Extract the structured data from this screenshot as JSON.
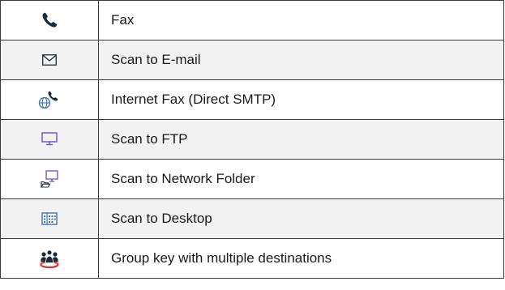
{
  "rows": [
    {
      "icon": "phone-icon",
      "label": "Fax"
    },
    {
      "icon": "envelope-icon",
      "label": "Scan to E-mail"
    },
    {
      "icon": "globe-phone-icon",
      "label": "Internet Fax (Direct SMTP)"
    },
    {
      "icon": "monitor-icon",
      "label": "Scan to FTP"
    },
    {
      "icon": "monitor-folder-icon",
      "label": "Scan to Network Folder"
    },
    {
      "icon": "desktop-grid-icon",
      "label": "Scan to Desktop"
    },
    {
      "icon": "group-icon",
      "label": "Group key with multiple destinations"
    }
  ],
  "colors": {
    "icon_dark": "#1a2a3a",
    "icon_blue": "#3d6fb5",
    "icon_purple": "#7050c8",
    "icon_red": "#d9342b",
    "border": "#3a3a3a",
    "alt_row": "#f2f2f2"
  }
}
